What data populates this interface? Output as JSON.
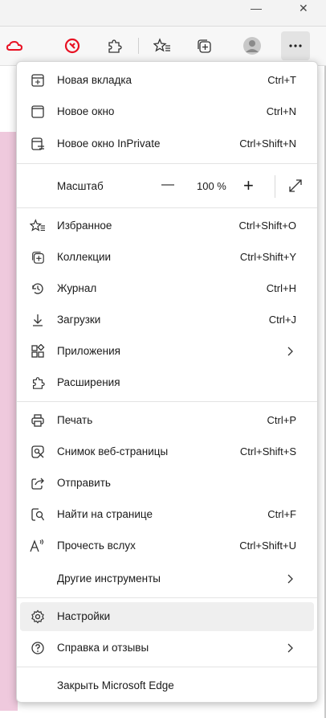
{
  "toolbar": {
    "icons": [
      "cloud-icon",
      "tracking-icon",
      "extensions-icon",
      "favorites-icon",
      "collections-icon",
      "profile-icon",
      "more-icon"
    ]
  },
  "menu": {
    "new_tab": {
      "label": "Новая вкладка",
      "shortcut": "Ctrl+T"
    },
    "new_window": {
      "label": "Новое окно",
      "shortcut": "Ctrl+N"
    },
    "new_inprivate": {
      "label": "Новое окно InPrivate",
      "shortcut": "Ctrl+Shift+N"
    },
    "zoom": {
      "label": "Масштаб",
      "minus": "—",
      "value": "100 %",
      "plus": "+"
    },
    "favorites": {
      "label": "Избранное",
      "shortcut": "Ctrl+Shift+O"
    },
    "collections": {
      "label": "Коллекции",
      "shortcut": "Ctrl+Shift+Y"
    },
    "history": {
      "label": "Журнал",
      "shortcut": "Ctrl+H"
    },
    "downloads": {
      "label": "Загрузки",
      "shortcut": "Ctrl+J"
    },
    "apps": {
      "label": "Приложения"
    },
    "extensions": {
      "label": "Расширения"
    },
    "print": {
      "label": "Печать",
      "shortcut": "Ctrl+P"
    },
    "screenshot": {
      "label": "Снимок веб-страницы",
      "shortcut": "Ctrl+Shift+S"
    },
    "share": {
      "label": "Отправить"
    },
    "find": {
      "label": "Найти на странице",
      "shortcut": "Ctrl+F"
    },
    "read_aloud": {
      "label": "Прочесть вслух",
      "shortcut": "Ctrl+Shift+U"
    },
    "more_tools": {
      "label": "Другие инструменты"
    },
    "settings": {
      "label": "Настройки"
    },
    "help": {
      "label": "Справка и отзывы"
    },
    "close_edge": {
      "label": "Закрыть Microsoft Edge"
    }
  },
  "colors": {
    "accent_red": "#e81123",
    "highlight": "#efefef",
    "page_pink": "#efc9dd"
  }
}
